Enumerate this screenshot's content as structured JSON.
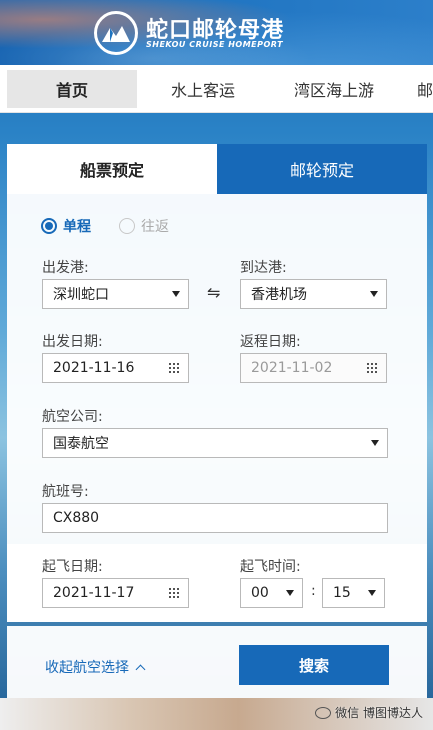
{
  "header": {
    "title": "蛇口邮轮母港",
    "subtitle": "SHEKOU CRUISE HOMEPORT",
    "logo_icon": "mountain-logo-icon"
  },
  "nav": {
    "items": [
      {
        "label": "首页",
        "active": true
      },
      {
        "label": "水上客运",
        "active": false
      },
      {
        "label": "湾区海上游",
        "active": false
      },
      {
        "label": "邮",
        "active": false
      }
    ]
  },
  "tabs": {
    "ferry": "船票预定",
    "cruise": "邮轮预定"
  },
  "trip_type": {
    "one_way": "单程",
    "round_trip": "往返",
    "selected": "one_way"
  },
  "form": {
    "departure_port_label": "出发港:",
    "departure_port_value": "深圳蛇口",
    "arrival_port_label": "到达港:",
    "arrival_port_value": "香港机场",
    "departure_date_label": "出发日期:",
    "departure_date_value": "2021-11-16",
    "return_date_label": "返程日期:",
    "return_date_value": "2021-11-02",
    "airline_label": "航空公司:",
    "airline_value": "国泰航空",
    "flight_no_label": "航班号:",
    "flight_no_value": "CX880",
    "takeoff_date_label": "起飞日期:",
    "takeoff_date_value": "2021-11-17",
    "takeoff_time_label": "起飞时间:",
    "takeoff_hour": "00",
    "takeoff_minute": "15",
    "time_separator": ":"
  },
  "actions": {
    "collapse_label": "收起航空选择",
    "search_label": "搜索"
  },
  "watermark": "微信 博图博达人",
  "colors": {
    "primary": "#1769b8",
    "header_bg": "#1e73c0"
  }
}
